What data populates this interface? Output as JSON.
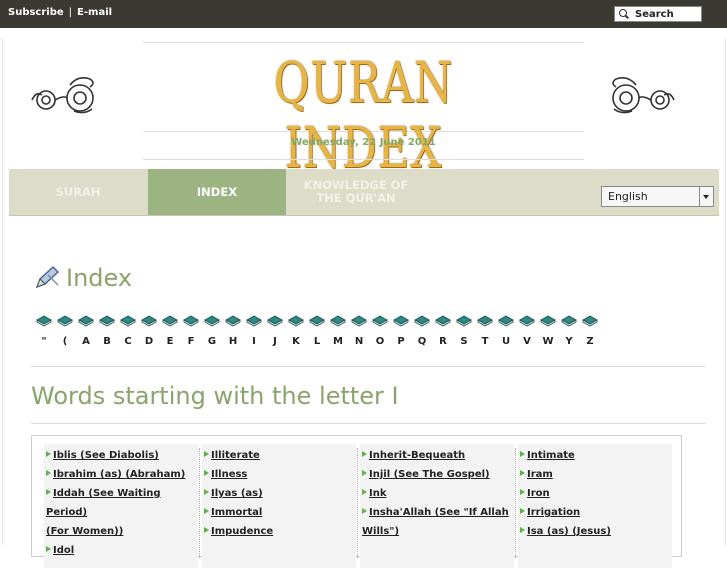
{
  "topbar": {
    "subscribe": "Subscribe",
    "separator": "|",
    "email": "E-mail",
    "search_label": "Search",
    "search_icon": "search-icon"
  },
  "header": {
    "logo_text": "QURAN INDEX",
    "date": "Wednesday, 22 June 2011"
  },
  "nav": {
    "tabs": [
      {
        "label": "SURAH"
      },
      {
        "label": "INDEX"
      },
      {
        "label": "KNOWLEDGE OF THE QUR'AN"
      }
    ],
    "active_tab": 1
  },
  "language": {
    "selected": "English"
  },
  "index": {
    "title": "Index",
    "letters": [
      "\"",
      "(",
      "A",
      "B",
      "C",
      "D",
      "E",
      "F",
      "G",
      "H",
      "I",
      "J",
      "K",
      "L",
      "M",
      "N",
      "O",
      "P",
      "Q",
      "R",
      "S",
      "T",
      "U",
      "V",
      "W",
      "Y",
      "Z"
    ]
  },
  "words": {
    "title": "Words starting with the letter I",
    "columns": [
      [
        {
          "text": "Iblis (See Diabolis)",
          "arrow": true
        },
        {
          "text": "Ibrahim (as) (Abraham)",
          "arrow": true
        },
        {
          "text": "Iddah (See Waiting Period)",
          "arrow": true
        },
        {
          "text": "(For Women))",
          "arrow": false
        },
        {
          "text": "Idol",
          "arrow": true
        }
      ],
      [
        {
          "text": "Illiterate",
          "arrow": true
        },
        {
          "text": "Illness",
          "arrow": true
        },
        {
          "text": "Ilyas (as)",
          "arrow": true
        },
        {
          "text": "Immortal",
          "arrow": true
        },
        {
          "text": "Impudence",
          "arrow": true
        }
      ],
      [
        {
          "text": "Inherit-Bequeath",
          "arrow": true
        },
        {
          "text": "Injil (See The Gospel)",
          "arrow": true
        },
        {
          "text": "Ink",
          "arrow": true
        },
        {
          "text": "Insha'Allah (See \"If Allah",
          "arrow": true
        },
        {
          "text": "Wills\")",
          "arrow": false
        }
      ],
      [
        {
          "text": "Intimate",
          "arrow": true
        },
        {
          "text": "Iram",
          "arrow": true
        },
        {
          "text": "Iron",
          "arrow": true
        },
        {
          "text": "Irrigation",
          "arrow": true
        },
        {
          "text": "Isa (as) (Jesus)",
          "arrow": true
        }
      ]
    ]
  },
  "colors": {
    "accent_green": "#8aa46b",
    "nav_bg": "#dcdcc9",
    "active_tab": "#9bb482",
    "logo_gold": "#e7b543",
    "topbar": "#3a3a32"
  }
}
